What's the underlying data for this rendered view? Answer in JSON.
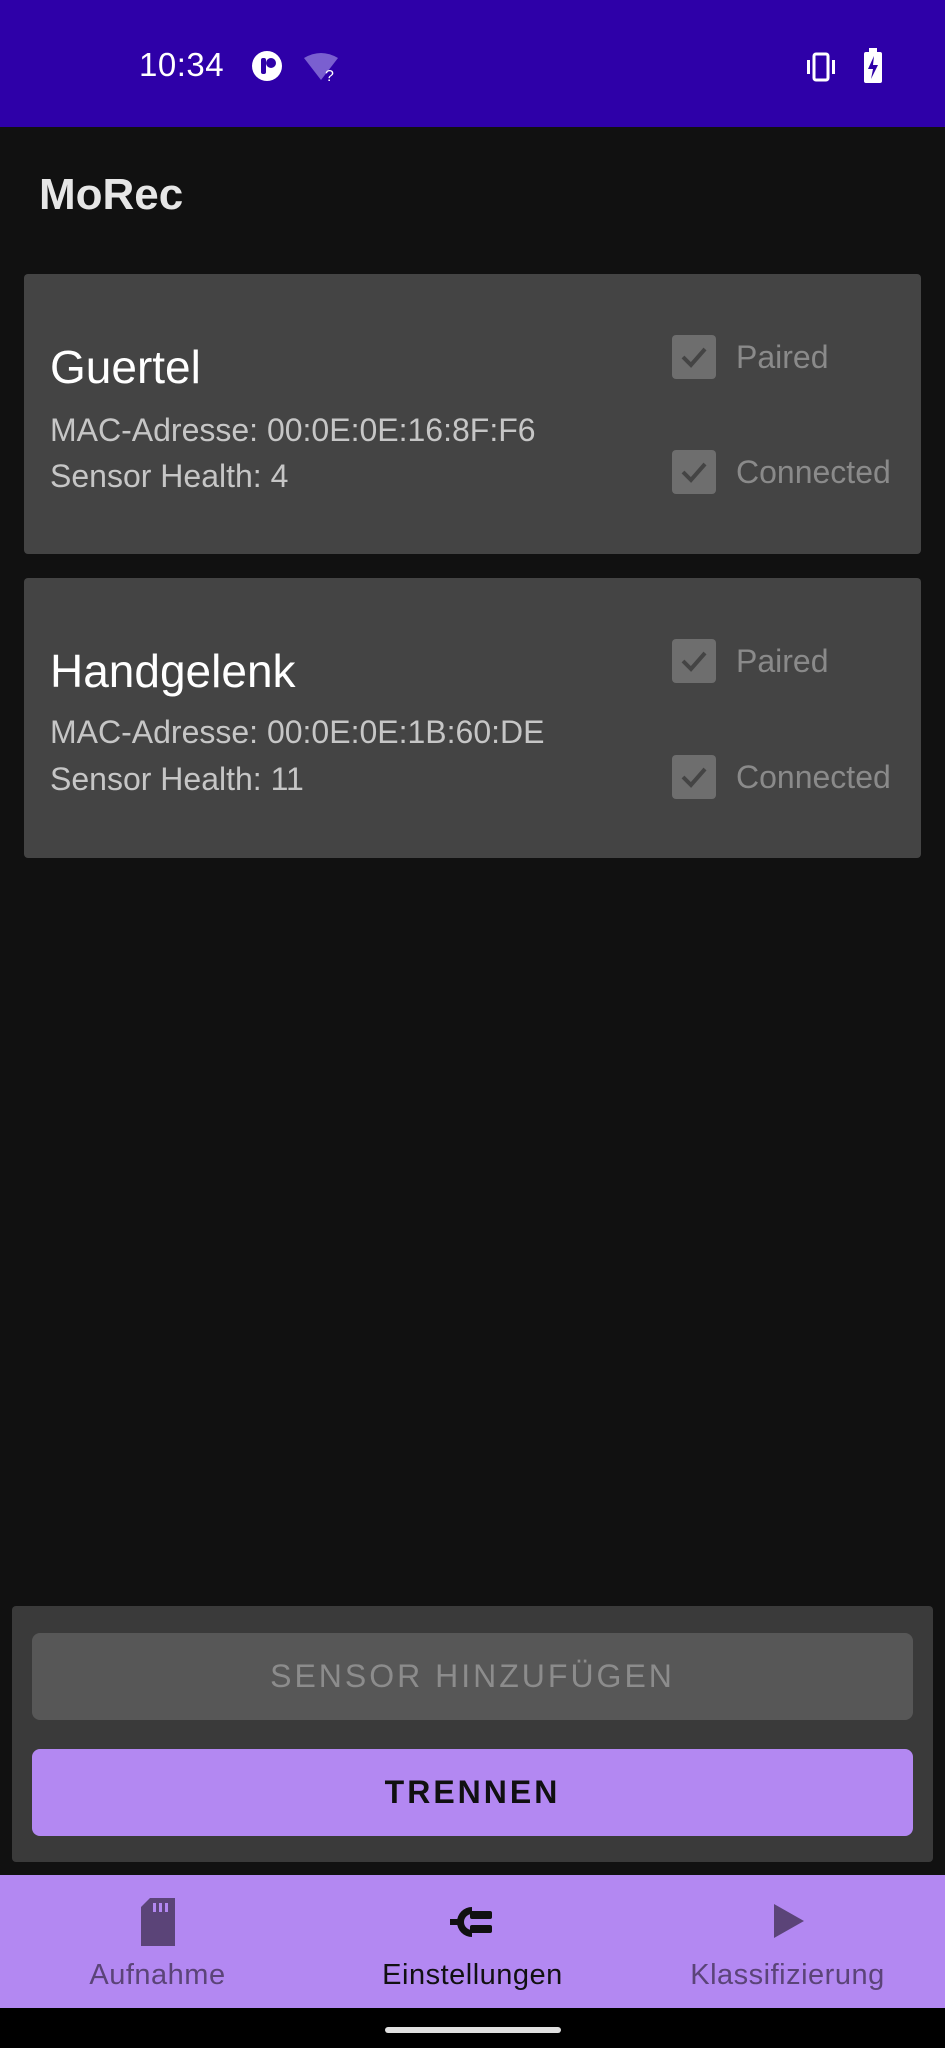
{
  "status_bar": {
    "time": "10:34",
    "background": "#2e00a8",
    "icons": [
      "notification-icon",
      "wifi-unknown-icon",
      "vibrate-icon",
      "battery-charging-icon"
    ],
    "wifi_unknown_mark": "?"
  },
  "app": {
    "title": "MoRec"
  },
  "sensors": [
    {
      "name": "Guertel",
      "mac": "MAC-Adresse: 00:0E:0E:16:8F:F6",
      "health": "Sensor Health: 4",
      "paired_label": "Paired",
      "paired": true,
      "connected_label": "Connected",
      "connected": true
    },
    {
      "name": "Handgelenk",
      "mac": "MAC-Adresse: 00:0E:0E:1B:60:DE",
      "health": "Sensor Health: 11",
      "paired_label": "Paired",
      "paired": true,
      "connected_label": "Connected",
      "connected": true
    }
  ],
  "actions": {
    "add_sensor_label": "SENSOR HINZUFÜGEN",
    "disconnect_label": "TRENNEN"
  },
  "bottom_nav": {
    "items": [
      {
        "label": "Aufnahme",
        "icon": "sd-card-icon",
        "active": false
      },
      {
        "label": "Einstellungen",
        "icon": "settings-plug-icon",
        "active": true
      },
      {
        "label": "Klassifizierung",
        "icon": "play-icon",
        "active": false
      }
    ]
  },
  "colors": {
    "accent": "#b388f2",
    "background": "#111111",
    "card": "#444444"
  }
}
